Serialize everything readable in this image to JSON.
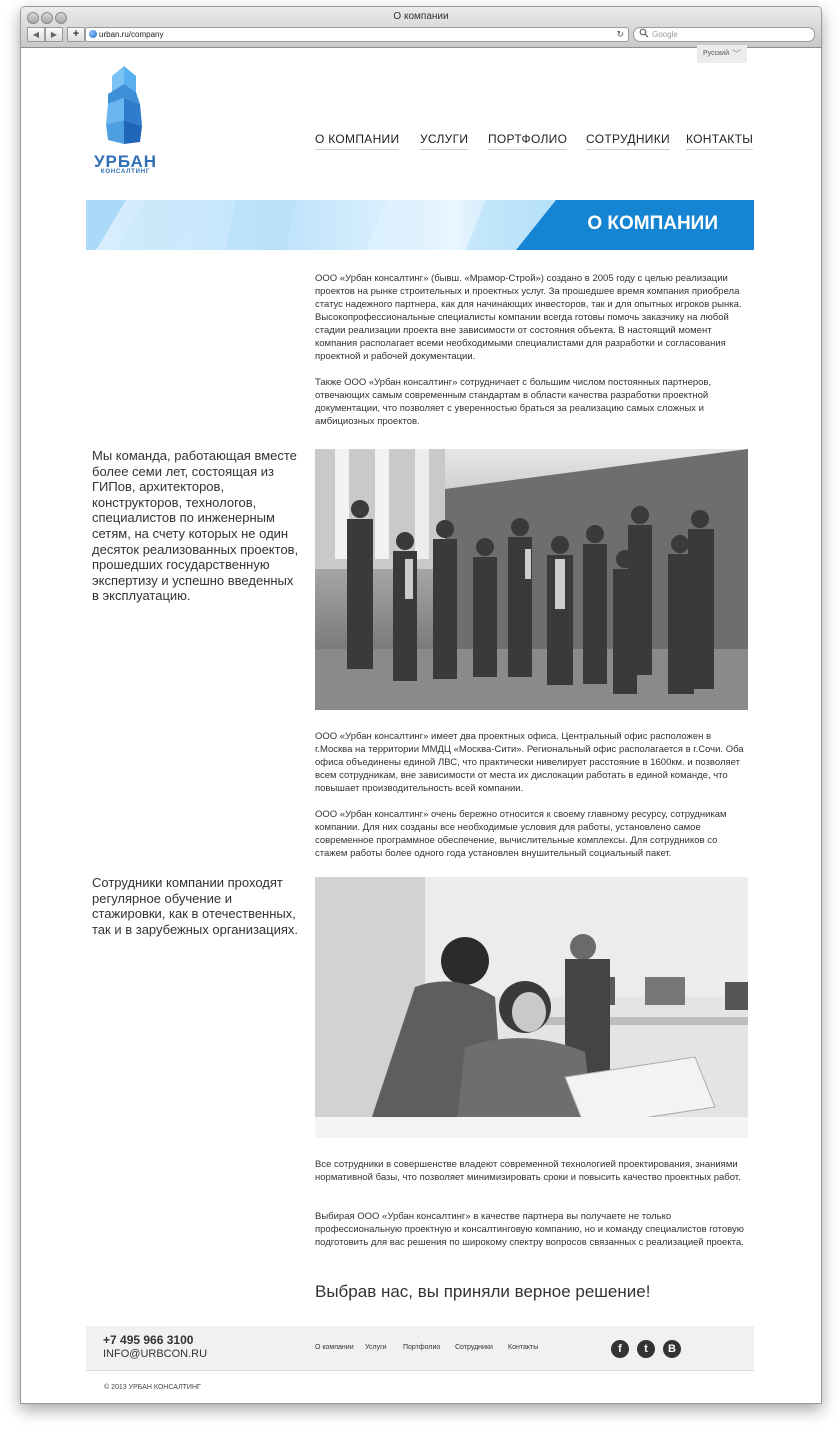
{
  "browser": {
    "window_title": "О компании",
    "url": "urban.ru/company",
    "search_placeholder": "Google",
    "back_label": "◀",
    "forward_label": "▶",
    "add_label": "+",
    "reload_label": "↻"
  },
  "header": {
    "language": "Русский",
    "logo_text": "УРБАН",
    "logo_subtext": "КОНСАЛТИНГ",
    "menu": [
      {
        "label": "О КОМПАНИИ"
      },
      {
        "label": "УСЛУГИ"
      },
      {
        "label": "ПОРТФОЛИО"
      },
      {
        "label": "СОТРУДНИКИ"
      },
      {
        "label": "КОНТАКТЫ"
      }
    ]
  },
  "banner": {
    "title": "О КОМПАНИИ"
  },
  "content": {
    "paragraphs": [
      "ООО «Урбан консалтинг» (бывш. «Мрамор-Строй») создано в 2005 году с целью реализации проектов на рынке строительных и проектных услуг. За прошедшее время компания приобрела статус надежного партнера, как для начинающих инвесторов, так и для опытных игроков рынка. Высокопрофессиональные специалисты компании всегда готовы помочь заказчику на любой стадии реализации проекта вне зависимости от состояния объекта. В настоящий момент компания располагает всеми необходимыми специалистами для разработки и согласования проектной и рабочей документации.",
      "Также ООО «Урбан консалтинг» сотрудничает с большим числом постоянных партнеров, отвечающих самым современным стандартам в области качества разработки проектной документации, что позволяет с уверенностью браться за реализацию самых сложных и амбициозных проектов.",
      "ООО «Урбан консалтинг» имеет два проектных офиса. Центральный офис расположен в г.Москва на территории ММДЦ «Москва-Сити». Региональный офис располагается в г.Сочи. Оба офиса объединены единой ЛВС, что практически нивелирует расстояние в 1600км. и позволяет всем сотрудникам, вне зависимости от места их дислокации работать в единой команде, что повышает производительность всей компании.",
      "ООО «Урбан консалтинг» очень бережно относится к своему главному ресурсу, сотрудникам компании. Для них созданы все необходимые условия для работы, установлено самое современное программное обеспечение, вычислительные комплексы. Для сотрудников со стажем работы более одного года установлен внушительный социальный пакет.",
      "Все сотрудники в совершенстве владеют современной технологией проектирования, знаниями нормативной базы, что позволяет минимизировать сроки и повысить качество проектных работ.",
      "Выбирая ООО «Урбан консалтинг» в качестве партнера вы получаете не только профессиональную проектную и консалтинговую компанию, но и команду специалистов готовую подготовить для вас решения по широкому спектру вопросов связанных с реализацией проекта."
    ],
    "side_texts": [
      "Мы команда, работающая вместе более семи лет, состоящая из ГИПов, архитекторов, конструкторов, технологов, специалистов по инженерным сетям, на счету которых не один десяток реализованных проектов, прошедших государственную экспертизу и успешно введенных в эксплуатацию.",
      "Сотрудники компании проходят регулярное обучение и стажировки, как в отечественных, так и в зарубежных организациях."
    ],
    "slogan": "Выбрав нас, вы приняли верное решение!"
  },
  "footer": {
    "phone": "+7 495 966 3100",
    "email": "INFO@URBCON.RU",
    "menu": [
      {
        "label": "О компании"
      },
      {
        "label": "Услуги"
      },
      {
        "label": "Портфолио"
      },
      {
        "label": "Сотрудники"
      },
      {
        "label": "Контакты"
      }
    ],
    "social": [
      {
        "icon": "facebook-icon",
        "glyph": "f"
      },
      {
        "icon": "twitter-icon",
        "glyph": "t"
      },
      {
        "icon": "vkontakte-icon",
        "glyph": "B"
      }
    ],
    "copyright": "© 2013 УРБАН КОНСАЛТИНГ"
  },
  "colors": {
    "brand_blue": "#2f6fb7",
    "banner_blue": "#1b8fd9",
    "text": "#333333",
    "footer_bg": "#f1f1f1"
  }
}
